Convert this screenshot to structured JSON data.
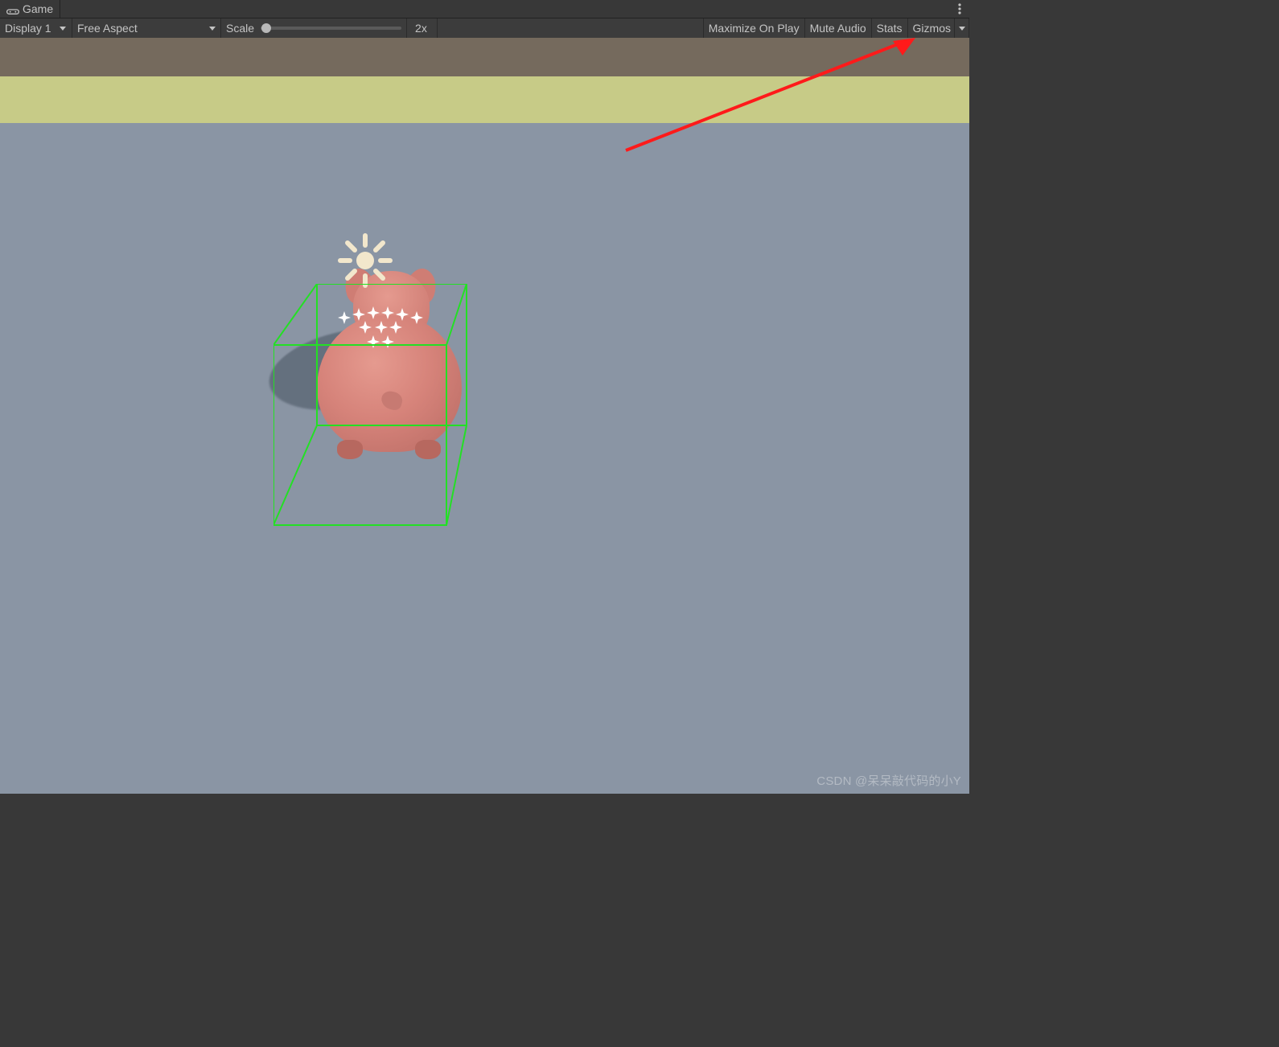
{
  "tab": {
    "title": "Game"
  },
  "toolbar": {
    "display": "Display 1",
    "aspect": "Free Aspect",
    "scale_label": "Scale",
    "scale_value": "2x",
    "scale_pos_pct": 4,
    "maximize": "Maximize On Play",
    "mute": "Mute Audio",
    "stats": "Stats",
    "gizmos": "Gizmos"
  },
  "gizmos": {
    "sun": "directional-light-gizmo",
    "particles": "particle-system-gizmo",
    "boxcollider": "box-collider-wireframe"
  },
  "colors": {
    "wire": "#23e024",
    "arrow": "#ff1a1a",
    "sun": "#f2e7cc",
    "spark": "#ffffff"
  },
  "watermark": "CSDN @呆呆敲代码的小Y"
}
